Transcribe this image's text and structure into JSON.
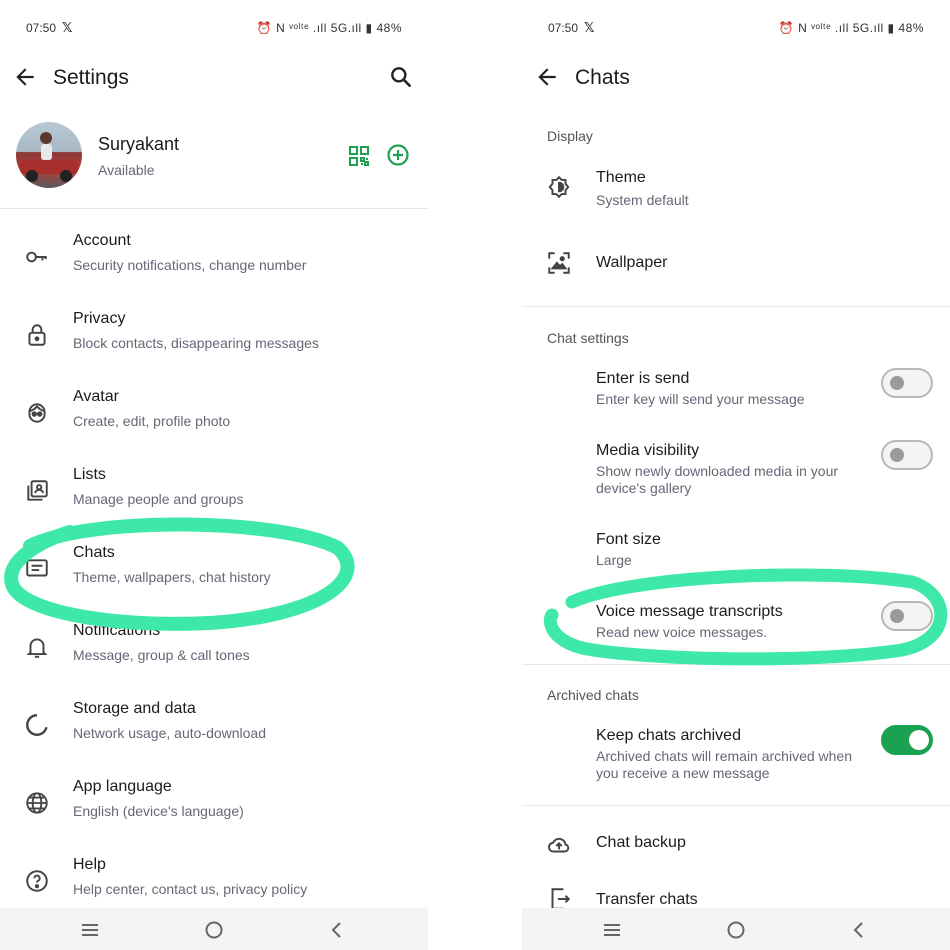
{
  "colors": {
    "accent": "#1aa152",
    "highlight": "#3de8a8"
  },
  "left": {
    "status": {
      "time": "07:50",
      "x_icon": "x-logo",
      "right": "⏰ N ᵛᵒˡᵗᵉ .ıll 5G.ıll ▮ 48%"
    },
    "header": {
      "title": "Settings"
    },
    "profile": {
      "name": "Suryakant",
      "status": "Available"
    },
    "items": [
      {
        "title": "Account",
        "subtitle": "Security notifications, change number",
        "icon": "key-icon"
      },
      {
        "title": "Privacy",
        "subtitle": "Block contacts, disappearing messages",
        "icon": "lock-icon"
      },
      {
        "title": "Avatar",
        "subtitle": "Create, edit, profile photo",
        "icon": "avatar-face-icon"
      },
      {
        "title": "Lists",
        "subtitle": "Manage people and groups",
        "icon": "lists-icon"
      },
      {
        "title": "Chats",
        "subtitle": "Theme, wallpapers, chat history",
        "icon": "chat-icon"
      },
      {
        "title": "Notifications",
        "subtitle": "Message, group & call tones",
        "icon": "bell-icon"
      },
      {
        "title": "Storage and data",
        "subtitle": "Network usage, auto-download",
        "icon": "storage-icon"
      },
      {
        "title": "App language",
        "subtitle": "English (device's language)",
        "icon": "globe-icon"
      },
      {
        "title": "Help",
        "subtitle": "Help center, contact us, privacy policy",
        "icon": "help-icon"
      }
    ]
  },
  "right": {
    "status": {
      "time": "07:50",
      "x_icon": "x-logo",
      "right": "⏰ N ᵛᵒˡᵗᵉ .ıll 5G.ıll ▮ 48%"
    },
    "header": {
      "title": "Chats"
    },
    "sections": {
      "display": "Display",
      "chat_settings": "Chat settings",
      "archived": "Archived chats"
    },
    "display": [
      {
        "title": "Theme",
        "subtitle": "System default",
        "icon": "theme-icon"
      },
      {
        "title": "Wallpaper",
        "subtitle": "",
        "icon": "wallpaper-icon"
      }
    ],
    "chat_settings": [
      {
        "title": "Enter is send",
        "subtitle": "Enter key will send your message",
        "on": false
      },
      {
        "title": "Media visibility",
        "subtitle": "Show newly downloaded media in your device's gallery",
        "on": false
      },
      {
        "title": "Font size",
        "subtitle": "Large"
      },
      {
        "title": "Voice message transcripts",
        "subtitle": "Read new voice messages.",
        "on": false
      }
    ],
    "archived": {
      "title": "Keep chats archived",
      "subtitle": "Archived chats will remain archived when you receive a new message",
      "on": true
    },
    "more": [
      {
        "title": "Chat backup",
        "icon": "cloud-upload-icon"
      },
      {
        "title": "Transfer chats",
        "icon": "transfer-icon"
      }
    ]
  }
}
